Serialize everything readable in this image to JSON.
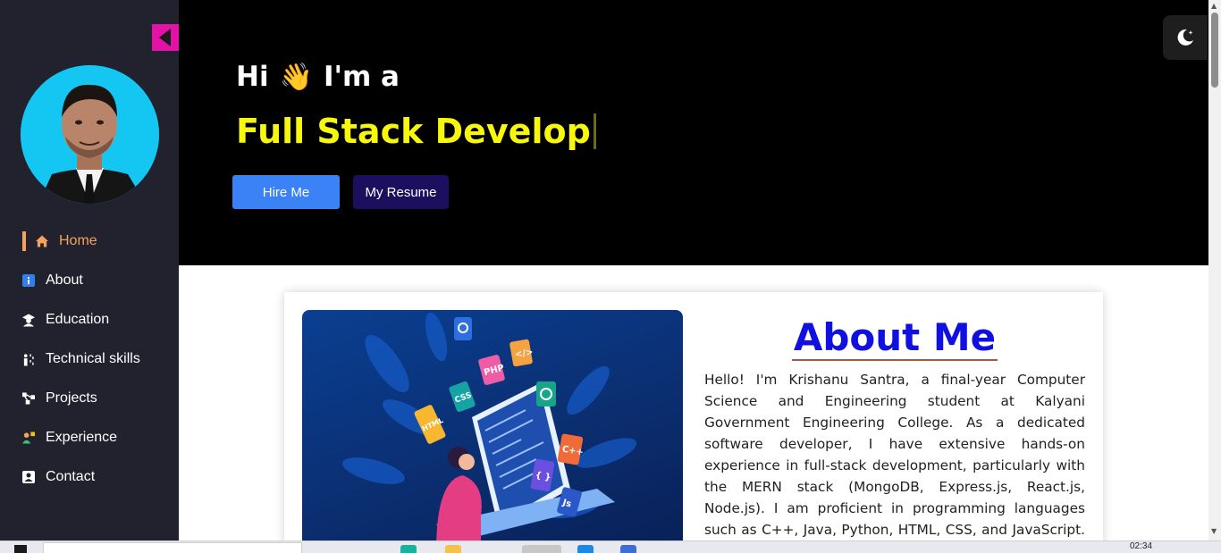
{
  "sidebar": {
    "items": [
      {
        "label": "Home",
        "icon": "home-icon",
        "active": true
      },
      {
        "label": "About",
        "icon": "info-icon",
        "active": false
      },
      {
        "label": "Education",
        "icon": "graduate-icon",
        "active": false
      },
      {
        "label": "Technical skills",
        "icon": "skills-icon",
        "active": false
      },
      {
        "label": "Projects",
        "icon": "project-icon",
        "active": false
      },
      {
        "label": "Experience",
        "icon": "experience-icon",
        "active": false
      },
      {
        "label": "Contact",
        "icon": "contact-icon",
        "active": false
      }
    ]
  },
  "hero": {
    "greeting_start": "Hi",
    "wave_emoji": "👋",
    "greeting_end": "I'm a",
    "typed_text": "Full Stack Develop",
    "hire_label": "Hire Me",
    "resume_label": "My Resume"
  },
  "about": {
    "title": "About Me",
    "text": "Hello! I'm Krishanu Santra, a final-year Computer Science and Engineering student at Kalyani Government Engineering College. As a dedicated software developer, I have extensive hands-on experience in full-stack development, particularly with the MERN stack (MongoDB, Express.js, React.js, Node.js). I am proficient in programming languages such as C++, Java, Python, HTML, CSS, and JavaScript. I am passionate about building web applications"
  },
  "illustration": {
    "badges": [
      "PHP",
      "</>",
      "CSS",
      "HTML",
      "C++",
      "{ }",
      "Js"
    ]
  },
  "taskbar": {
    "time": "02:34"
  },
  "colors": {
    "accent_active": "#f5a25d",
    "typed_yellow": "#f7f70c",
    "hire_blue": "#3b82f6",
    "resume_navy": "#1c0f5e",
    "collapse_pink": "#e312a6",
    "sidebar_bg": "#22212e",
    "title_blue": "#1010e0"
  }
}
